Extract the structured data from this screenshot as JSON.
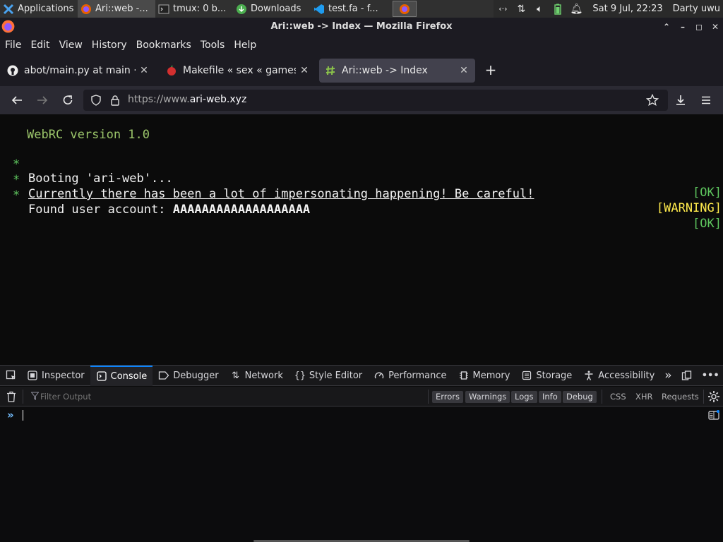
{
  "panel": {
    "apps_label": "Applications",
    "tasks": [
      {
        "label": "Ari::web -..."
      },
      {
        "label": "tmux: 0 b..."
      },
      {
        "label": "Downloads"
      },
      {
        "label": "test.fa - f..."
      }
    ],
    "clock": "Sat  9 Jul, 22:23",
    "user": "Darty uwu"
  },
  "window": {
    "title": "Ari::web -> Index — Mozilla Firefox"
  },
  "menubar": {
    "items": [
      "File",
      "Edit",
      "View",
      "History",
      "Bookmarks",
      "Tools",
      "Help"
    ]
  },
  "tabs": [
    {
      "title": "abot/main.py at main · Tr",
      "active": false
    },
    {
      "title": "Makefile « sex « games ·",
      "active": false
    },
    {
      "title": "Ari::web -> Index",
      "active": true
    }
  ],
  "nav": {
    "url_prefix": "https://www.",
    "url_host": "ari-web.xyz"
  },
  "page": {
    "header": "WebRC version 1.0",
    "lines": [
      {
        "bullet": "*",
        "text": "Booting 'ari-web'...",
        "status": "[OK]"
      },
      {
        "bullet": "*",
        "text": "Currently there has been a lot of impersonating happening! Be careful!",
        "status": "[WARNING]"
      },
      {
        "bullet": "*",
        "text": "Found user account: ",
        "account": "AAAAAAAAAAAAAAAAAAA",
        "status": "[OK]"
      }
    ],
    "colors": {
      "ok": "#5ec65e",
      "warning": "#ffeb4c",
      "header": "#9bc56a"
    }
  },
  "devtools": {
    "tabs": [
      "Inspector",
      "Console",
      "Debugger",
      "Network",
      "Style Editor",
      "Performance",
      "Memory",
      "Storage",
      "Accessibility"
    ],
    "active_tab": "Console",
    "filter_placeholder": "Filter Output",
    "levels": [
      "Errors",
      "Warnings",
      "Logs",
      "Info",
      "Debug"
    ],
    "types": [
      "CSS",
      "XHR",
      "Requests"
    ],
    "prompt": "»"
  }
}
